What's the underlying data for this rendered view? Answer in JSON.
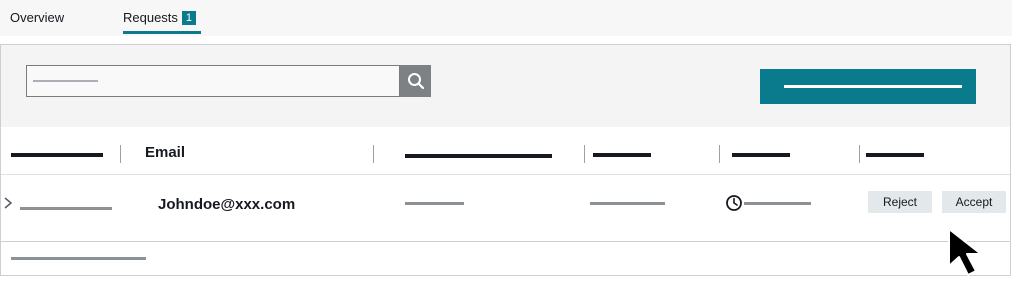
{
  "tabs": [
    {
      "label": "Overview",
      "active": false
    },
    {
      "label": "Requests",
      "active": true,
      "badge": "1"
    }
  ],
  "toolbar": {
    "search_icon": "search-icon",
    "primary_button_icon": "placeholder-line"
  },
  "table": {
    "columns": [
      "",
      "Email",
      "",
      "",
      "",
      ""
    ],
    "rows": [
      {
        "email": "Johndoe@xxx.com",
        "time_icon": "clock-icon",
        "actions": [
          "Reject",
          "Accept"
        ]
      }
    ]
  },
  "colors": {
    "accent": "#0a7b8c",
    "search_button": "#7e8184",
    "action_button": "#e3e8ea",
    "text": "#16191f"
  },
  "cursor": "arrow-cursor-icon"
}
